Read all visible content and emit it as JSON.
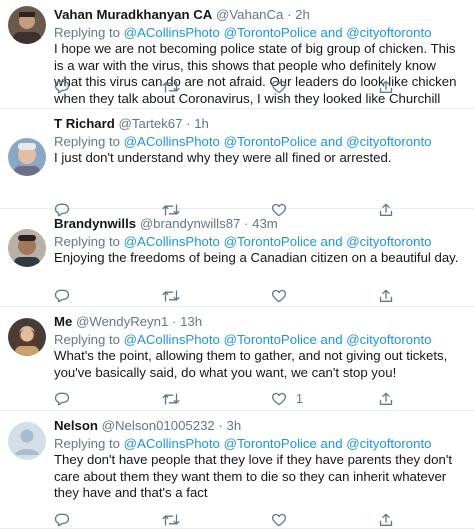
{
  "reply_prefix": "Replying to",
  "and_word": "and",
  "tweets": [
    {
      "name": "Vahan Muradkhanyan CA",
      "handle": "@VahanCa",
      "dot": "·",
      "time": "2h",
      "mentions": [
        "@ACollinsPhoto",
        "@TorontoPolice",
        "@cityoftoronto"
      ],
      "text": "I hope we are not becoming police state of big group of chicken. This is a war with the virus, this shows that people who definitely know what this virus can do are not afraid. Our leaders do look like chicken when they talk about Coronavirus, I wish they looked like Churchill",
      "like_count": ""
    },
    {
      "name": "T Richard",
      "handle": "@Tartek67",
      "dot": "·",
      "time": "1h",
      "mentions": [
        "@ACollinsPhoto",
        "@TorontoPolice",
        "@cityoftoronto"
      ],
      "text": "I just don't understand why they were all fined or arrested.",
      "like_count": ""
    },
    {
      "name": "Brandynwills",
      "handle": "@brandynwills87",
      "dot": "·",
      "time": "43m",
      "mentions": [
        "@ACollinsPhoto",
        "@TorontoPolice",
        "@cityoftoronto"
      ],
      "text": "Enjoying the freedoms of being a Canadian citizen on a beautiful day.",
      "like_count": ""
    },
    {
      "name": "Me",
      "handle": "@WendyReyn1",
      "dot": "·",
      "time": "13h",
      "mentions": [
        "@ACollinsPhoto",
        "@TorontoPolice",
        "@cityoftoronto"
      ],
      "text": "What's the point, allowing them to gather, and not giving out tickets, you've basically said, do what you want, we can't stop you!",
      "like_count": "1"
    },
    {
      "name": "Nelson",
      "handle": "@Nelson01005232",
      "dot": "·",
      "time": "3h",
      "mentions": [
        "@ACollinsPhoto",
        "@TorontoPolice",
        "@cityoftoronto"
      ],
      "text": "They don't have people that they love if they have parents they don't care about them they want them to die so they can inherit whatever they have and that's a fact",
      "like_count": ""
    }
  ],
  "colors": {
    "link": "#1b95e0",
    "secondary_text": "#657786",
    "divider": "#e6ecf0"
  },
  "icons": [
    "reply-icon",
    "retweet-icon",
    "like-icon",
    "share-icon"
  ]
}
